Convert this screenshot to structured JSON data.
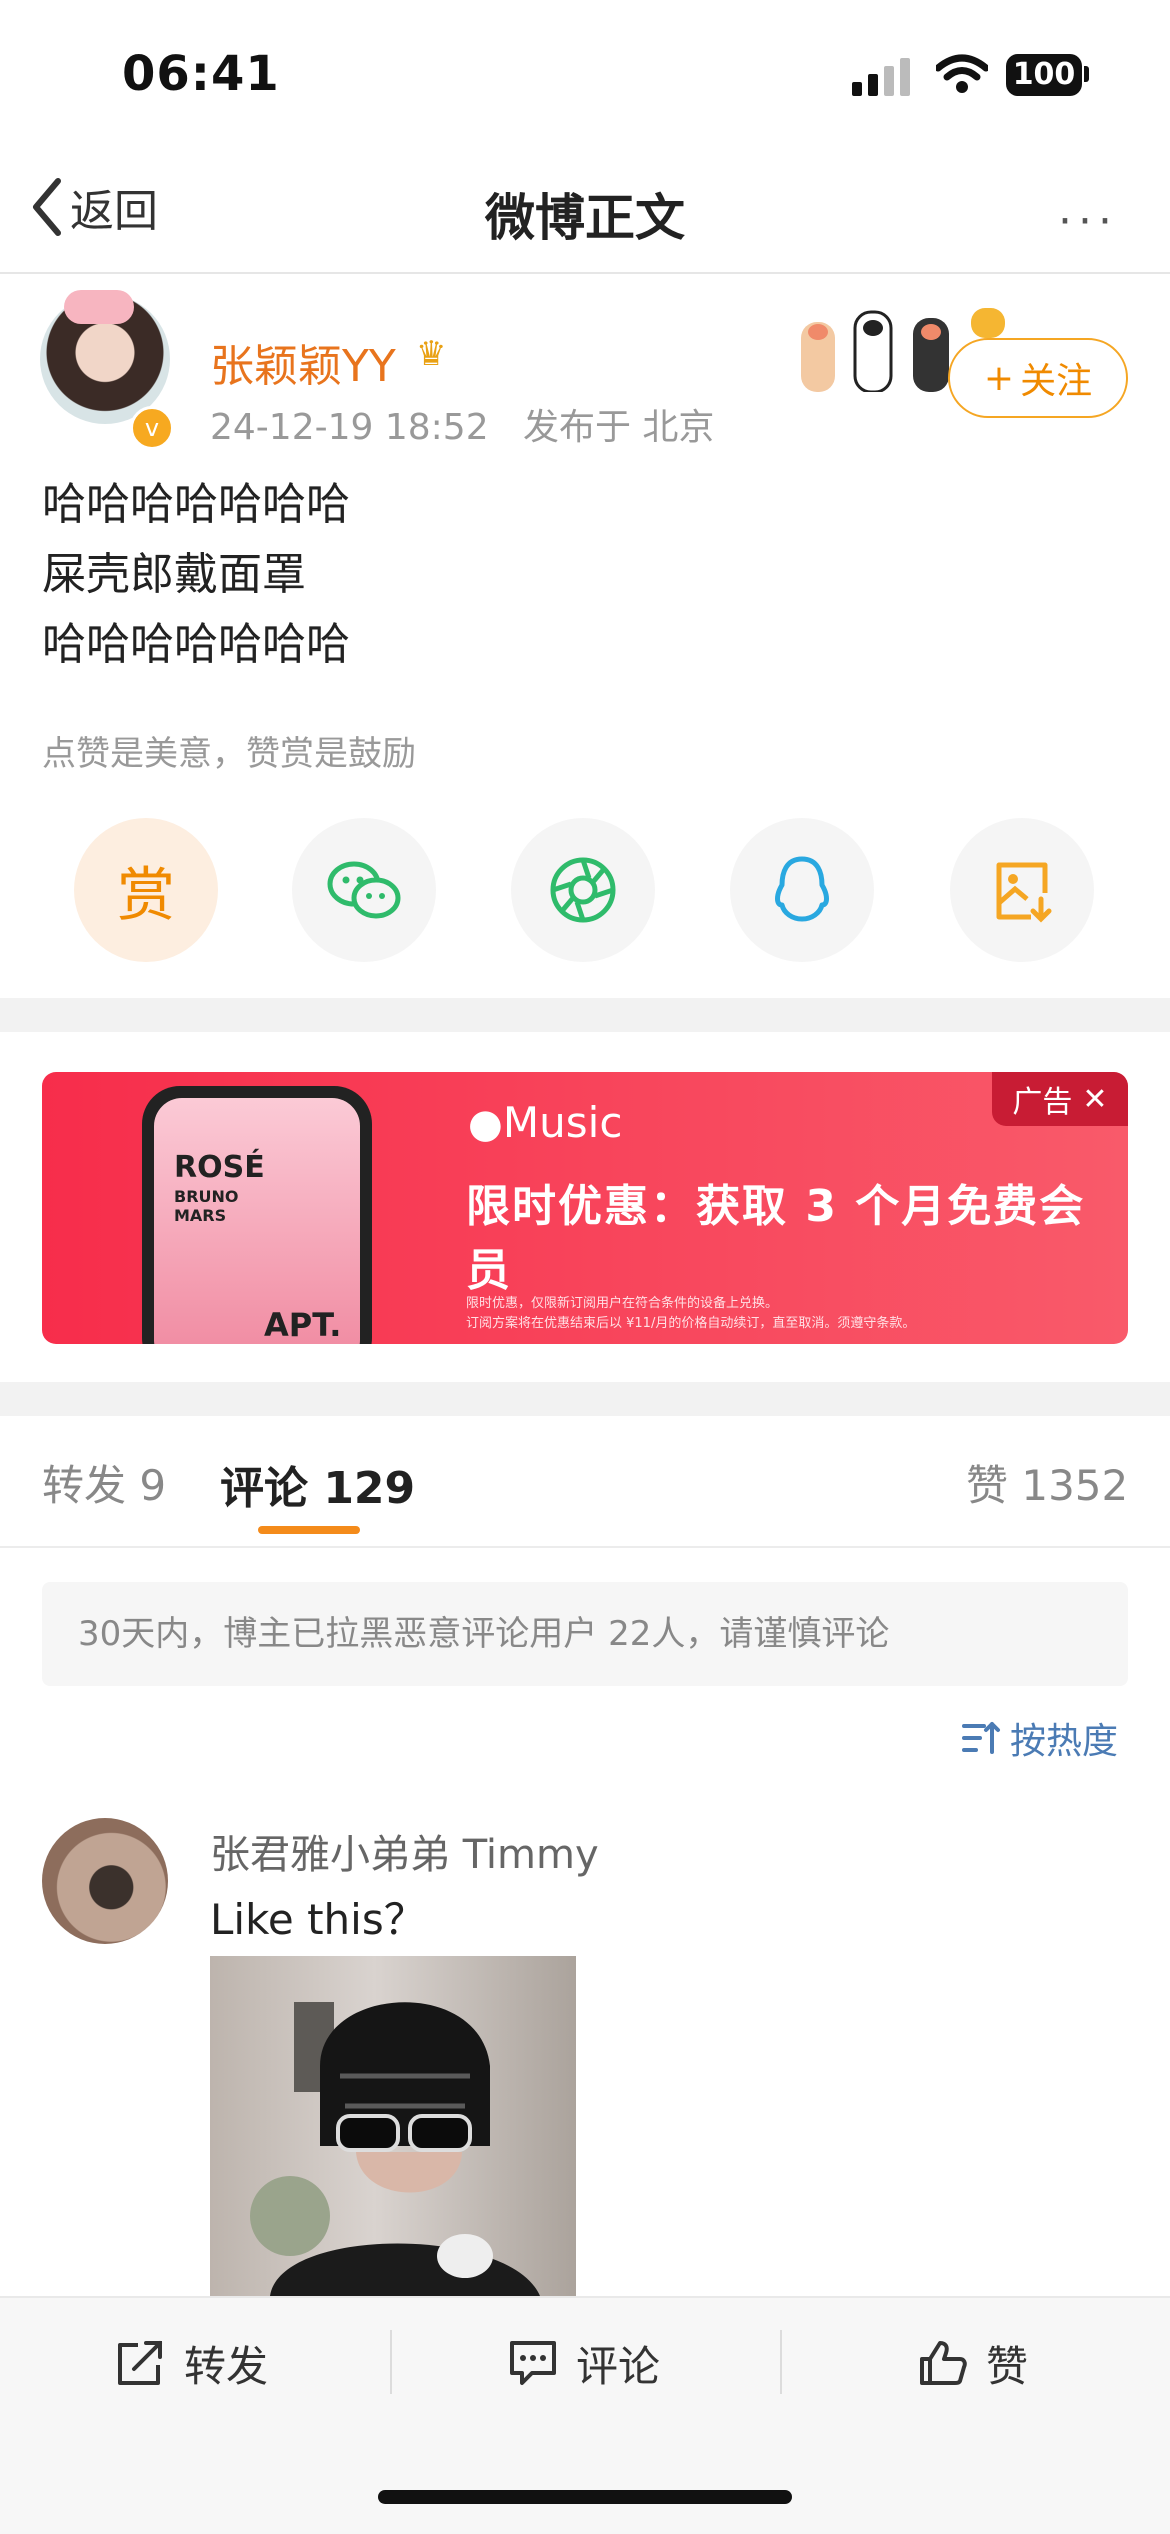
{
  "status_bar": {
    "time": "06:41",
    "battery": "100"
  },
  "nav": {
    "back_label": "返回",
    "title": "微博正文",
    "more": "···"
  },
  "post": {
    "author": "张颖颖YY",
    "verified_mark": "v",
    "timestamp": "24-12-19 18:52",
    "location": "发布于 北京",
    "follow_label": "关注",
    "follow_plus": "+",
    "text": "哈哈哈哈哈哈哈\n屎壳郎戴面罩\n哈哈哈哈哈哈哈",
    "reward_hint": "点赞是美意，赞赏是鼓励",
    "reward_glyph": "赏"
  },
  "share_icons": [
    "reward-icon",
    "wechat-icon",
    "moments-icon",
    "qq-icon",
    "save-image-icon"
  ],
  "ad": {
    "brand": "Music",
    "headline": "限时优惠：获取 3 个月免费会员",
    "fine_print_1": "限时优惠，仅限新订阅用户在符合条件的设备上兑换。",
    "fine_print_2": "订阅方案将在优惠结束后以 ¥11/月的价格自动续订，直至取消。须遵守条款。",
    "album_line1": "ROSÉ",
    "album_line2": "BRUNO\nMARS",
    "album_title": "APT.",
    "badge": "广告",
    "badge_close": "✕"
  },
  "tabs": {
    "repost": "转发 9",
    "comments": "评论 129",
    "likes": "赞 1352"
  },
  "notice": "30天内，博主已拉黑恶意评论用户 22人，请谨慎评论",
  "sort_label": "按热度",
  "comment": {
    "author": "张君雅小弟弟 Timmy",
    "text": "Like this？"
  },
  "bottom_bar": {
    "repost": "转发",
    "comment": "评论",
    "like": "赞"
  },
  "colors": {
    "accent_orange": "#f08a00",
    "link_blue": "#4b7bb4",
    "ad_red": "#f72d4b",
    "wechat_green": "#2fbb6b",
    "qq_blue": "#29a8e0"
  }
}
